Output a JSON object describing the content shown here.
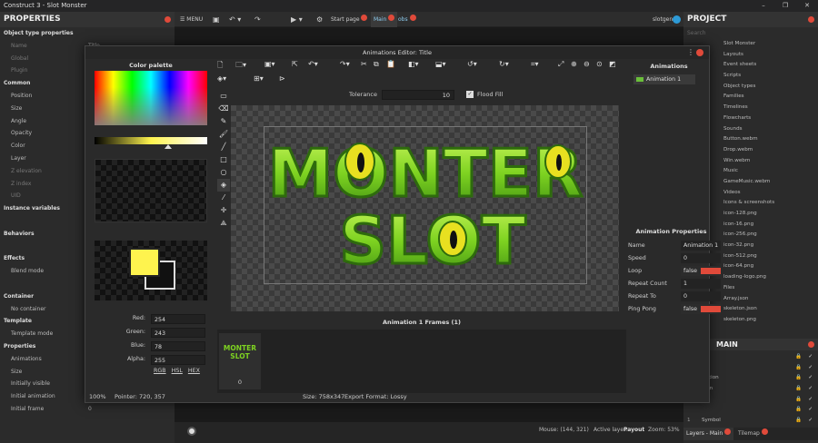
{
  "window": {
    "title": "Construct 3 - Slot Monster",
    "controls": [
      "–",
      "❐",
      "✕"
    ]
  },
  "properties_panel": {
    "title": "PROPERTIES",
    "rows": [
      {
        "label": "Object type properties",
        "kind": "sec",
        "value": ""
      },
      {
        "label": "Name",
        "kind": "dim",
        "value": "Title"
      },
      {
        "label": "Global",
        "kind": "dim",
        "value": ""
      },
      {
        "label": "Plugin",
        "kind": "dim",
        "value": ""
      },
      {
        "label": "Common",
        "kind": "sec",
        "value": ""
      },
      {
        "label": "Position",
        "kind": "row",
        "value": ""
      },
      {
        "label": "Size",
        "kind": "row",
        "value": ""
      },
      {
        "label": "Angle",
        "kind": "row",
        "value": ""
      },
      {
        "label": "Opacity",
        "kind": "row",
        "value": ""
      },
      {
        "label": "Color",
        "kind": "row",
        "value": ""
      },
      {
        "label": "Layer",
        "kind": "row",
        "value": ""
      },
      {
        "label": "Z elevation",
        "kind": "dim",
        "value": ""
      },
      {
        "label": "Z index",
        "kind": "dim",
        "value": ""
      },
      {
        "label": "UID",
        "kind": "dim",
        "value": ""
      },
      {
        "label": "Instance variables",
        "kind": "sec",
        "value": ""
      },
      {
        "label": "",
        "kind": "row",
        "value": "Instance"
      },
      {
        "label": "Behaviors",
        "kind": "sec",
        "value": ""
      },
      {
        "label": "",
        "kind": "row",
        "value": "Beha"
      },
      {
        "label": "Effects",
        "kind": "sec",
        "value": ""
      },
      {
        "label": "Blend mode",
        "kind": "row",
        "value": ""
      },
      {
        "label": "",
        "kind": "row",
        "value": "Eff"
      },
      {
        "label": "Container",
        "kind": "sec",
        "value": ""
      },
      {
        "label": "No container",
        "kind": "row",
        "value": ""
      },
      {
        "label": "Template",
        "kind": "sec",
        "value": ""
      },
      {
        "label": "Template mode",
        "kind": "row",
        "value": ""
      },
      {
        "label": "Properties",
        "kind": "sec",
        "value": ""
      },
      {
        "label": "Animations",
        "kind": "row",
        "value": ""
      },
      {
        "label": "Size",
        "kind": "row",
        "value": ""
      },
      {
        "label": "Initially visible",
        "kind": "row",
        "value": "true"
      },
      {
        "label": "Initial animation",
        "kind": "row",
        "value": "Animation 1"
      },
      {
        "label": "Initial frame",
        "kind": "row",
        "value": "0"
      }
    ]
  },
  "main_toolbar": {
    "menu_label": "MENU",
    "start_page_label": "Start page",
    "tabs": [
      "Main",
      "obs"
    ],
    "user": "slotgen"
  },
  "project_panel": {
    "title": "PROJECT",
    "search_placeholder": "Search",
    "rows": [
      "Slot Monster",
      "Layouts",
      "Event sheets",
      "Scripts",
      "Object types",
      "Families",
      "Timelines",
      "Flowcharts",
      "Sounds",
      "Button.webm",
      "Drop.webm",
      "Win.webm",
      "Music",
      "GameMusic.webm",
      "Videos",
      "Icons & screenshots",
      "icon-128.png",
      "icon-16.png",
      "icon-256.png",
      "icon-32.png",
      "icon-512.png",
      "icon-64.png",
      "loading-logo.png",
      "Files",
      "Array.json",
      "skeleton.json",
      "skeleton.png"
    ],
    "layers_title": "MAIN",
    "layers": [
      "",
      "",
      "Option",
      "Spin",
      "",
      "",
      "Symbol",
      "BG"
    ],
    "layer_numbers": [
      "",
      "",
      "",
      "",
      "",
      "",
      "1",
      "0"
    ],
    "bottom_tabs": [
      "Layers - Main",
      "Tilemap"
    ]
  },
  "dialog": {
    "title": "Animations Editor: Title",
    "palette_title": "Color palette",
    "rgb": [
      {
        "label": "Red:",
        "value": "254"
      },
      {
        "label": "Green:",
        "value": "243"
      },
      {
        "label": "Blue:",
        "value": "78"
      },
      {
        "label": "Alpha:",
        "value": "255"
      }
    ],
    "modes": [
      "RGB",
      "HSL",
      "HEX"
    ],
    "primary_color": "#fef34e",
    "secondary_color": "#111111",
    "tolerance_label": "Tolerance",
    "tolerance_value": "10",
    "flood_fill_label": "Flood Fill",
    "canvas_text": [
      "MONTER",
      "SLOT"
    ],
    "frames_title": "Animation 1 Frames (1)",
    "frame_label": "0",
    "frame_thumb_text": [
      "MONTER",
      "SLOT"
    ],
    "animations_title": "Animations",
    "animations": [
      "Animation 1"
    ],
    "anim_props_title": "Animation Properties",
    "anim_props": [
      {
        "label": "Name",
        "value": "Animation 1",
        "red": false
      },
      {
        "label": "Speed",
        "value": "0",
        "red": false
      },
      {
        "label": "Loop",
        "value": "false",
        "red": true
      },
      {
        "label": "Repeat Count",
        "value": "1",
        "red": false
      },
      {
        "label": "Repeat To",
        "value": "0",
        "red": false
      },
      {
        "label": "Ping Pong",
        "value": "false",
        "red": true
      }
    ],
    "zoom": "100%",
    "pointer": "Pointer: 720, 357",
    "size": "Size: 758x347",
    "export": "Export Format: Lossy"
  },
  "statusbar": {
    "mouse": "Mouse: (144, 321)",
    "active_layer_label": "Active layer:",
    "active_layer": "Payout",
    "zoom": "Zoom: 53%"
  },
  "colors": {
    "accent_red": "#e04a3a",
    "slime_green": "#7ed321",
    "slime_dark": "#2e6b0d"
  }
}
